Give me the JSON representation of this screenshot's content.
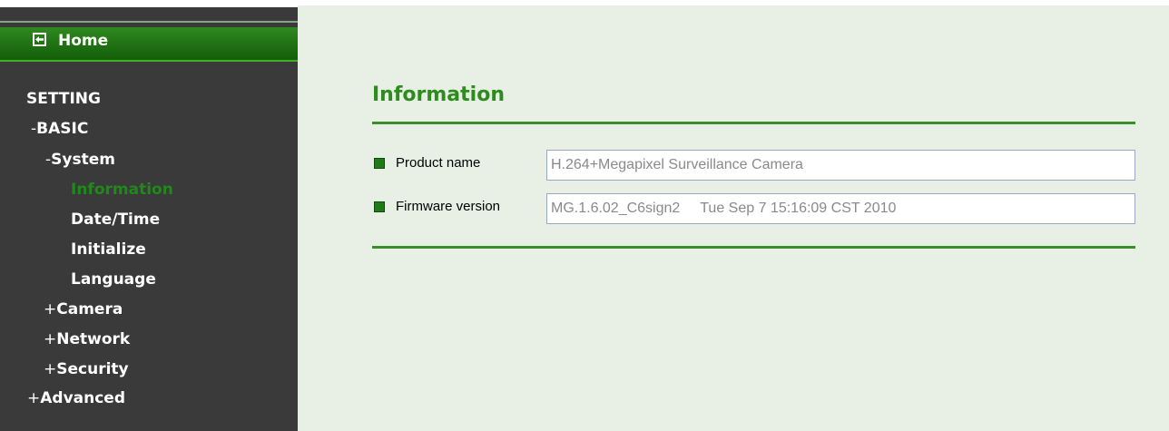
{
  "sidebar": {
    "home": "Home",
    "setting": "SETTING",
    "basic": "BASIC",
    "system": "System",
    "information": "Information",
    "datetime": "Date/Time",
    "initialize": "Initialize",
    "language": "Language",
    "camera": "Camera",
    "network": "Network",
    "security": "Security",
    "advanced": "Advanced",
    "minus": "-",
    "plus": "+"
  },
  "main": {
    "title": "Information",
    "product_label": "Product name",
    "product_value": "H.264+Megapixel Surveillance Camera",
    "firmware_label": "Firmware version",
    "firmware_value": "MG.1.6.02_C6sign2     Tue Sep 7 15:16:09 CST 2010"
  },
  "colors": {
    "sidebar_bg": "#3a3a3a",
    "home_green": "#1e6e12",
    "active_green": "#1f8a1a",
    "title_green": "#2e8b1e",
    "content_bg": "#e8f0e6"
  },
  "icons": {
    "home": "back-arrow-icon"
  }
}
